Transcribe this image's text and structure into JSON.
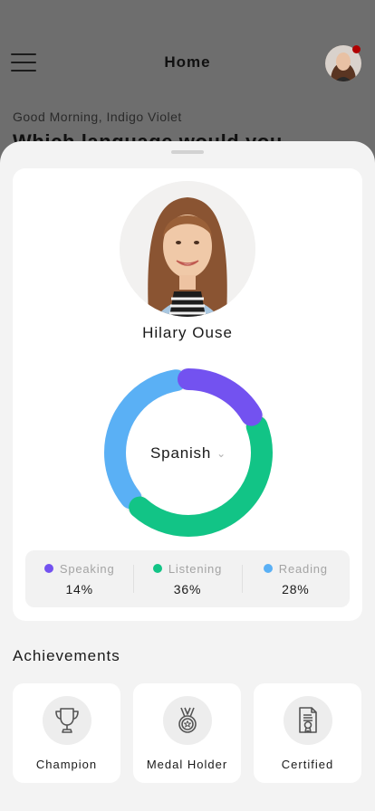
{
  "header": {
    "title": "Home",
    "greeting": "Good Morning, Indigo Violet",
    "question": "Which language would you"
  },
  "profile": {
    "name": "Hilary Ouse"
  },
  "progress": {
    "language": "Spanish",
    "items": [
      {
        "label": "Speaking",
        "value": "14%",
        "color": "#7352f0"
      },
      {
        "label": "Listening",
        "value": "36%",
        "color": "#12c486"
      },
      {
        "label": "Reading",
        "value": "28%",
        "color": "#5ab0f5"
      }
    ]
  },
  "chart_data": {
    "type": "donut",
    "center_label": "Spanish",
    "series": [
      {
        "name": "Speaking",
        "value": 14,
        "color": "#7352f0"
      },
      {
        "name": "Listening",
        "value": 36,
        "color": "#12c486"
      },
      {
        "name": "Reading",
        "value": 28,
        "color": "#5ab0f5"
      }
    ],
    "track_color": "#f2f2f2"
  },
  "achievements": {
    "title": "Achievements",
    "items": [
      {
        "label": "Champion",
        "icon": "trophy-icon"
      },
      {
        "label": "Medal Holder",
        "icon": "medal-icon"
      },
      {
        "label": "Certified",
        "icon": "certificate-icon"
      }
    ]
  }
}
